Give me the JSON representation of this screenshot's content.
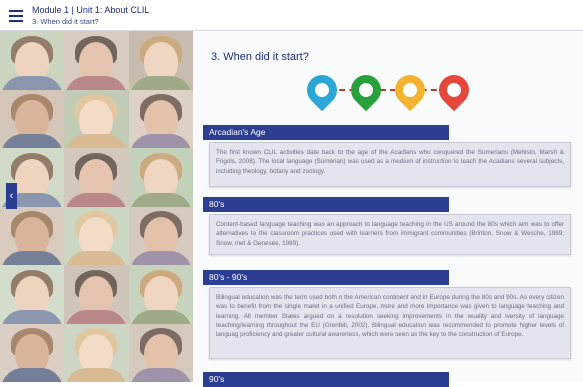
{
  "header": {
    "breadcrumb": "Module 1 | Unit 1: About CLIL",
    "subtitle": "3. When did it start?"
  },
  "page_title": "3. When did it start?",
  "timeline_pins": [
    {
      "icon": "map-pin-icon",
      "color": "#2aa7d6"
    },
    {
      "icon": "map-pin-icon",
      "color": "#27a13a"
    },
    {
      "icon": "map-pin-icon",
      "color": "#f3b331"
    },
    {
      "icon": "map-pin-icon",
      "color": "#e5473a"
    }
  ],
  "sections": [
    {
      "title": "Arcadian's Age",
      "text": "The first known CLIL activities date back to the age of the Acadians who conquered the Sumerians (Mehisto, Marsh & Frigols, 2008). The local language (Sumerian) was used as a medium of instruction to teach the Acadians several subjects, including theology, botany and zoology."
    },
    {
      "title": "80's",
      "text": "Content-based language teaching was an approach to language teaching in the US around the 80s which aim was to offer alternatives to the classroom practices used with learners from immigrant communities (Brinton, Snow & Wesche, 1989; Snow, met & Genesee, 1989)."
    },
    {
      "title": "80's - 90's",
      "text": "Bilingual education was the term used both n the American continent and in Europe during the 80s and 90s. As every citizen was to benefit from the single maret in a unified Europe, more and more importance was given to language teaching and learning. All member States argued on a resolution seeking improvements in the wuality and iversity of language teaching/learning throughout the EU (Grenfell, 2002). Bilingual education was recommended to promote higher levels of languag proficiency and greater cultural awareness, which were seen as the key to the construction of Europe."
    },
    {
      "title": "90's",
      "text": ""
    }
  ],
  "colors": {
    "accent": "#2c3e91",
    "box_bg": "#e3e5ee"
  }
}
